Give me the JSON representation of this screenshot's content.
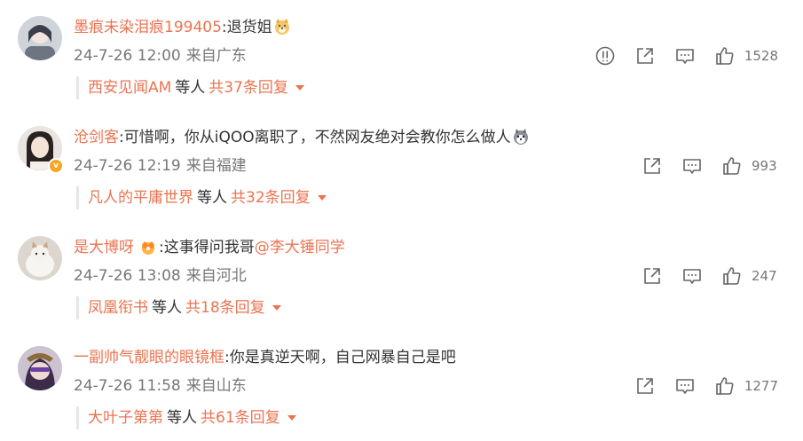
{
  "comments": [
    {
      "username": "墨痕未染泪痕199405",
      "text": ":退货姐",
      "emoji": "doge-emoji",
      "time": "24-7-26 12:00",
      "location": "来自广东",
      "likes": "1528",
      "reply_user": "西安见闻AM",
      "reply_etc": "等人",
      "reply_total": "共37条回复"
    },
    {
      "username": "沧剑客",
      "text": ":可惜啊，你从iQOO离职了，不然网友绝对会教你怎么做人",
      "emoji": "husky-emoji",
      "time": "24-7-26 12:19",
      "location": "来自福建",
      "likes": "993",
      "reply_user": "凡人的平庸世界",
      "reply_etc": "等人",
      "reply_total": "共32条回复"
    },
    {
      "username": "是大博呀",
      "text": ":这事得问我哥",
      "mention": "@李大锤同学",
      "time": "24-7-26 13:08",
      "location": "来自河北",
      "likes": "247",
      "reply_user": "凤凰衔书",
      "reply_etc": "等人",
      "reply_total": "共18条回复"
    },
    {
      "username": "一副帅气靓眼的眼镜框",
      "text": ":你是真逆天啊，自己网暴自己是吧",
      "time": "24-7-26 11:58",
      "location": "来自山东",
      "likes": "1277",
      "reply_user": "大叶子第第",
      "reply_etc": "等人",
      "reply_total": "共61条回复"
    }
  ],
  "colors": {
    "accent": "#eb7350",
    "meta": "#777777",
    "icon": "#666666",
    "verified": "#f5a623"
  },
  "icons": [
    "report-icon",
    "share-icon",
    "comment-icon",
    "like-icon",
    "crown-icon"
  ]
}
